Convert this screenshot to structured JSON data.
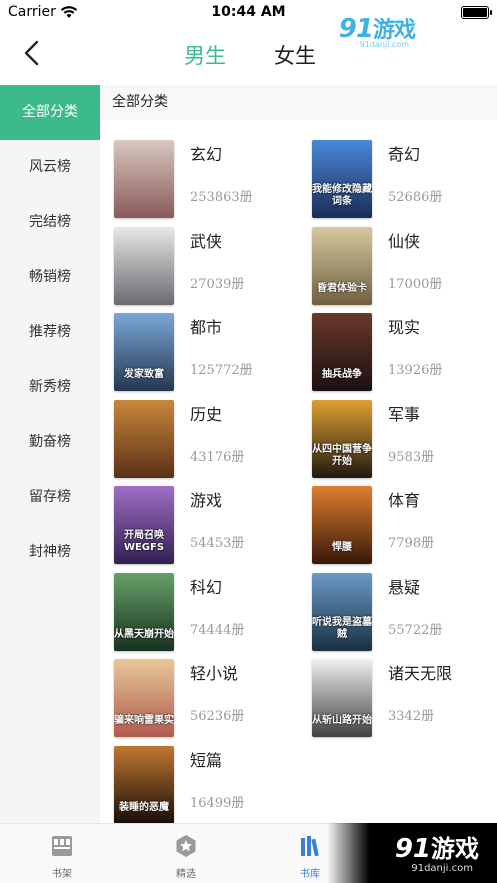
{
  "status_bar": {
    "carrier": "Carrier",
    "time": "10:44 AM"
  },
  "watermark_top": {
    "brand": "9",
    "brand_tail": "1",
    "text": "游戏",
    "domain": "91danji.com"
  },
  "header": {
    "tabs": [
      "男生",
      "女生"
    ],
    "active_tab": 0
  },
  "sidebar": {
    "items": [
      "全部分类",
      "风云榜",
      "完结榜",
      "畅销榜",
      "推荐榜",
      "新秀榜",
      "勤奋榜",
      "留存榜",
      "封神榜"
    ],
    "active": 0
  },
  "main": {
    "title": "全部分类",
    "categories": [
      {
        "name": "玄幻",
        "count": "253863册",
        "cover_text": "",
        "colors": [
          "#d8c8c0",
          "#8a5a58"
        ]
      },
      {
        "name": "奇幻",
        "count": "52686册",
        "cover_text": "我能修改隐藏词条",
        "colors": [
          "#4a88d8",
          "#1a2c58"
        ]
      },
      {
        "name": "武侠",
        "count": "27039册",
        "cover_text": "",
        "colors": [
          "#e8e8e8",
          "#6a6a70"
        ]
      },
      {
        "name": "仙侠",
        "count": "17000册",
        "cover_text": "昏君体验卡",
        "colors": [
          "#d8c8a0",
          "#706040"
        ]
      },
      {
        "name": "都市",
        "count": "125772册",
        "cover_text": "发家致富",
        "colors": [
          "#7aa8d8",
          "#243850"
        ]
      },
      {
        "name": "现实",
        "count": "13926册",
        "cover_text": "抽兵战争",
        "colors": [
          "#6a3a2a",
          "#1a1010"
        ]
      },
      {
        "name": "历史",
        "count": "43176册",
        "cover_text": "",
        "colors": [
          "#c8883a",
          "#5a3018"
        ]
      },
      {
        "name": "军事",
        "count": "9583册",
        "cover_text": "从四中国营争开始",
        "colors": [
          "#e0a030",
          "#201810"
        ]
      },
      {
        "name": "游戏",
        "count": "54453册",
        "cover_text": "开局召唤WEGFS",
        "colors": [
          "#a070c8",
          "#302050"
        ]
      },
      {
        "name": "体育",
        "count": "7798册",
        "cover_text": "悍腰",
        "colors": [
          "#e08030",
          "#381808"
        ]
      },
      {
        "name": "科幻",
        "count": "74444册",
        "cover_text": "从黑天崩开始",
        "colors": [
          "#68a068",
          "#183020"
        ]
      },
      {
        "name": "悬疑",
        "count": "55722册",
        "cover_text": "听说我是盗墓贼",
        "colors": [
          "#6a9ac8",
          "#1a3040"
        ]
      },
      {
        "name": "轻小说",
        "count": "56236册",
        "cover_text": "骗来响雷果实",
        "colors": [
          "#e8c898",
          "#b05a50"
        ]
      },
      {
        "name": "诸天无限",
        "count": "3342册",
        "cover_text": "从斩山路开始",
        "colors": [
          "#f0f0f0",
          "#404040"
        ]
      },
      {
        "name": "短篇",
        "count": "16499册",
        "cover_text": "装睡的恶魔",
        "colors": [
          "#c07830",
          "#180c08"
        ]
      }
    ]
  },
  "tabbar": {
    "items": [
      {
        "label": "书架",
        "icon": "bookshelf-icon"
      },
      {
        "label": "精选",
        "icon": "star-badge-icon"
      },
      {
        "label": "书库",
        "icon": "library-icon"
      }
    ],
    "active": 2
  },
  "watermark_bottom": {
    "brand": "9",
    "brand_tail": "1",
    "text": "游戏",
    "domain": "91danji.com"
  },
  "colors": {
    "accent": "#3dba8b",
    "tab_active": "#3a7fd8",
    "sidebar_bg": "#f5f5f5"
  }
}
